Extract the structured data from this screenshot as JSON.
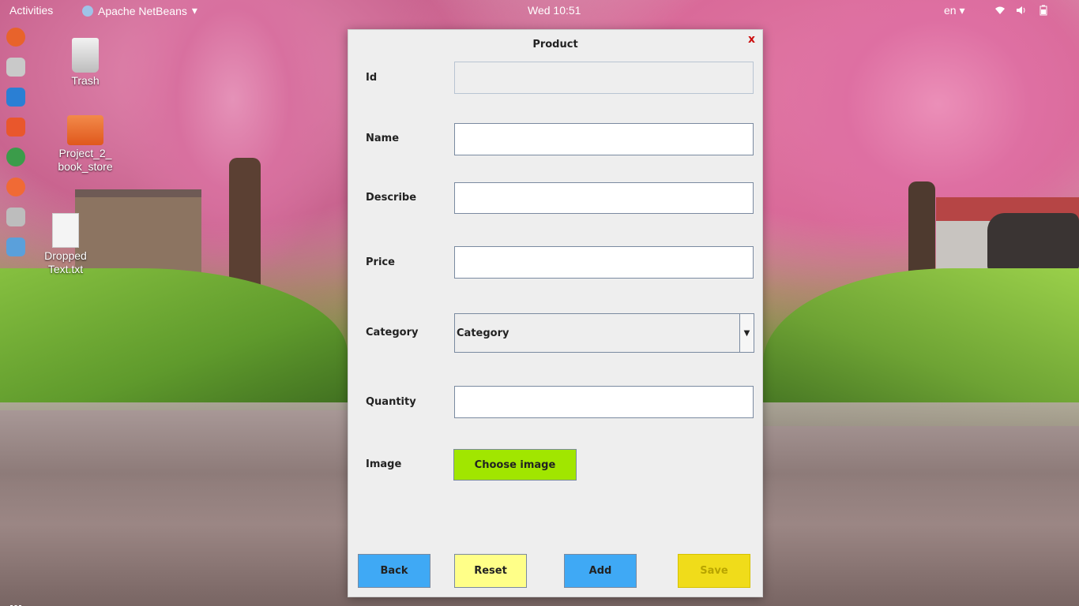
{
  "topbar": {
    "activities": "Activities",
    "app_name": "Apache NetBeans",
    "app_menu_arrow": "▾",
    "clock": "Wed 10:51",
    "language": "en",
    "language_arrow": "▾",
    "tray_icons": [
      "network-icon",
      "volume-icon",
      "battery-icon"
    ]
  },
  "dock": {
    "icons": [
      {
        "name": "firefox-icon",
        "color": "#e8632b"
      },
      {
        "name": "files-manager-icon",
        "color": "#c9c9c9"
      },
      {
        "name": "libreoffice-writer-icon",
        "color": "#2a7fd4"
      },
      {
        "name": "software-center-icon",
        "color": "#e9572c"
      },
      {
        "name": "chrome-icon",
        "color": "#3b9c4a"
      },
      {
        "name": "postman-icon",
        "color": "#f06a35"
      },
      {
        "name": "screenshot-icon",
        "color": "#bdbdbd"
      },
      {
        "name": "netbeans-icon",
        "color": "#5aa0db"
      }
    ],
    "show_apps": "⋮⋮⋮"
  },
  "desktop": {
    "trash_label": "Trash",
    "project_label": "Project_2_\nbook_store",
    "project_line1": "Project_2_",
    "project_line2": "book_store",
    "file_line1": "Dropped",
    "file_line2": "Text.txt"
  },
  "dialog": {
    "title": "Product",
    "close": "x",
    "labels": {
      "id": "Id",
      "name": "Name",
      "describe": "Describe",
      "price": "Price",
      "category": "Category",
      "quantity": "Quantity",
      "image": "Image"
    },
    "values": {
      "id": "",
      "name": "",
      "describe": "",
      "price": "",
      "quantity": ""
    },
    "category_selected": "Category",
    "combo_arrow": "▼",
    "buttons": {
      "choose_image": "Choose image",
      "back": "Back",
      "reset": "Reset",
      "add": "Add",
      "save": "Save"
    },
    "colors": {
      "choose_image": "#a1e600",
      "back": "#3fa9f5",
      "reset": "#ffff88",
      "add": "#3fa9f5",
      "save": "#f0dc1a"
    }
  }
}
